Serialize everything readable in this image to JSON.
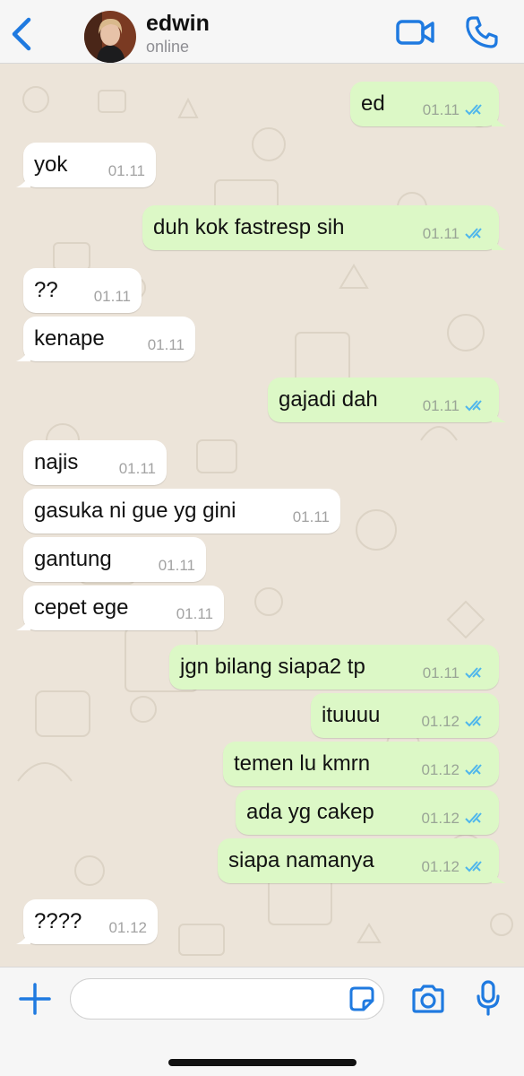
{
  "header": {
    "contact_name": "edwin",
    "status": "online",
    "icons": [
      "chevron-left-icon",
      "video-camera-icon",
      "phone-icon"
    ]
  },
  "messages": [
    {
      "dir": "out",
      "text": "ed",
      "time": "01.11",
      "read": true
    },
    {
      "dir": "in",
      "text": "yok",
      "time": "01.11"
    },
    {
      "dir": "out",
      "text": "duh kok fastresp sih",
      "time": "01.11",
      "read": true
    },
    {
      "dir": "in",
      "text": "??",
      "time": "01.11"
    },
    {
      "dir": "in",
      "text": "kenape",
      "time": "01.11"
    },
    {
      "dir": "out",
      "text": "gajadi dah",
      "time": "01.11",
      "read": true
    },
    {
      "dir": "in",
      "text": "najis",
      "time": "01.11"
    },
    {
      "dir": "in",
      "text": "gasuka ni gue yg gini",
      "time": "01.11"
    },
    {
      "dir": "in",
      "text": "gantung",
      "time": "01.11"
    },
    {
      "dir": "in",
      "text": "cepet ege",
      "time": "01.11"
    },
    {
      "dir": "out",
      "text": "jgn bilang siapa2 tp",
      "time": "01.11",
      "read": true
    },
    {
      "dir": "out",
      "text": "ituuuu",
      "time": "01.12",
      "read": true
    },
    {
      "dir": "out",
      "text": "temen lu kmrn",
      "time": "01.12",
      "read": true
    },
    {
      "dir": "out",
      "text": "ada yg cakep",
      "time": "01.12",
      "read": true
    },
    {
      "dir": "out",
      "text": "siapa namanya",
      "time": "01.12",
      "read": true
    },
    {
      "dir": "in",
      "text": "????",
      "time": "01.12"
    }
  ],
  "composer": {
    "placeholder": "",
    "icons": [
      "plus-icon",
      "sticker-icon",
      "camera-icon",
      "microphone-icon"
    ]
  },
  "colors": {
    "accent": "#1f7ae0",
    "incoming_bubble": "#ffffff",
    "outgoing_bubble": "#dcf8c6",
    "read_ticks": "#4fb6ec",
    "chat_background": "#ece4d9"
  }
}
